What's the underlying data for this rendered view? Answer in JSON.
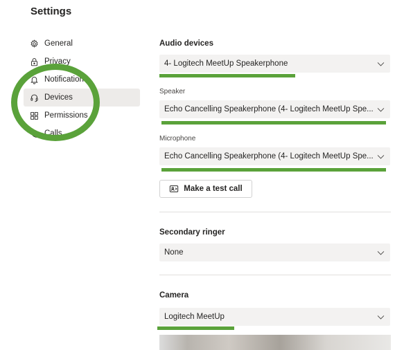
{
  "page": {
    "title": "Settings"
  },
  "sidebar": {
    "items": [
      {
        "label": "General",
        "icon": "gear-icon"
      },
      {
        "label": "Privacy",
        "icon": "lock-icon"
      },
      {
        "label": "Notifications",
        "icon": "bell-icon"
      },
      {
        "label": "Devices",
        "icon": "headset-icon",
        "active": true
      },
      {
        "label": "Permissions",
        "icon": "grid-icon"
      },
      {
        "label": "Calls",
        "icon": "phone-icon"
      }
    ]
  },
  "audio": {
    "title": "Audio devices",
    "device_value": "4- Logitech MeetUp Speakerphone",
    "speaker_label": "Speaker",
    "speaker_value": "Echo Cancelling Speakerphone (4- Logitech MeetUp Spe...",
    "microphone_label": "Microphone",
    "microphone_value": "Echo Cancelling Speakerphone (4- Logitech MeetUp Spe...",
    "test_call_label": "Make a test call"
  },
  "secondary_ringer": {
    "title": "Secondary ringer",
    "value": "None"
  },
  "camera": {
    "title": "Camera",
    "value": "Logitech MeetUp"
  },
  "annotation": {
    "color": "#5aa23a"
  },
  "colors": {
    "dropdown_bg": "#f3f2f1",
    "active_nav_bg": "#edebe9"
  }
}
